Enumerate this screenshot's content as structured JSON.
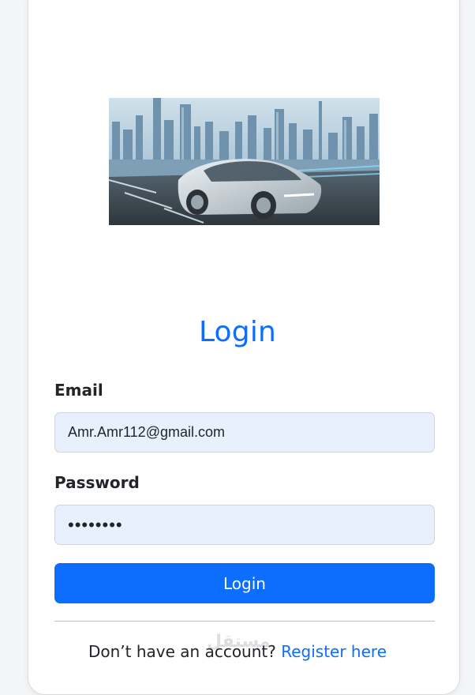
{
  "hero_image": {
    "icon": "futuristic-car-city-illustration"
  },
  "login": {
    "title": "Login",
    "email_label": "Email",
    "email_value": "Amr.Amr112@gmail.com",
    "password_label": "Password",
    "password_value": "••••••••",
    "submit_label": "Login"
  },
  "footer": {
    "prompt": "Don’t have an account? ",
    "register_link": "Register here"
  },
  "watermark": {
    "text": "مستقل"
  },
  "colors": {
    "accent": "#0d6efd",
    "field_bg": "#e8f0fe",
    "text": "#212529",
    "card_bg": "#ffffff"
  }
}
